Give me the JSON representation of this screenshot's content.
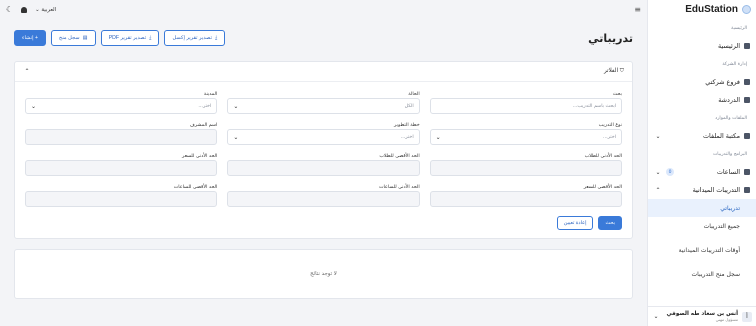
{
  "app": {
    "brand": "EduStation"
  },
  "topbar": {
    "language": "العربية",
    "menu_icon": "hamburger-icon"
  },
  "sidebar": {
    "sections": [
      {
        "title": "الرئيسية",
        "items": [
          {
            "label": "الرئيسية",
            "icon": "home-icon"
          }
        ]
      },
      {
        "title": "إدارة الشركة",
        "items": [
          {
            "label": "فروع شركتي",
            "icon": "building-icon"
          },
          {
            "label": "الدردشة",
            "icon": "chat-icon"
          }
        ]
      },
      {
        "title": "الملفات والموارد",
        "items": [
          {
            "label": "مكتبة الملفات",
            "icon": "folder-icon"
          }
        ]
      },
      {
        "title": "البرامج والتدريبات",
        "items": [
          {
            "label": "الساعات",
            "icon": "clock-icon",
            "badge": "0"
          },
          {
            "label": "التدريبات الميدانية",
            "icon": "training-icon"
          }
        ]
      }
    ],
    "sub_items": [
      "تدريباتي",
      "جميع التدريبات",
      "أوقات التدريبات الميدانية",
      "سجل منح التدريبات"
    ],
    "user": {
      "name": "أنس بن سعاد طه الصوفي",
      "role": "مسؤول مهني",
      "initial": "أ"
    }
  },
  "page": {
    "title": "تدريباتي",
    "buttons": {
      "create": "+ إنشاء",
      "grant_log": "سجل منح",
      "export_pdf": "تصدير تقرير PDF",
      "export_excel": "تصدير تقرير إكسل"
    }
  },
  "filters": {
    "title": "الفلاتر",
    "fields": [
      {
        "label": "بحث",
        "placeholder": "ابحث باسم التدريب..."
      },
      {
        "label": "الحالة",
        "value": "الكل"
      },
      {
        "label": "المدينة",
        "value": "اختر..."
      },
      {
        "label": "نوع التدريب",
        "value": "اختر..."
      },
      {
        "label": "خطة التطوير",
        "value": "اختر..."
      },
      {
        "label": "اسم المشرف",
        "value": ""
      },
      {
        "label": "الحد الأدنى للطلاب",
        "value": ""
      },
      {
        "label": "الحد الأقصى للطلاب",
        "value": ""
      },
      {
        "label": "الحد الأدنى للسعر",
        "value": ""
      },
      {
        "label": "الحد الأقصى للسعر",
        "value": ""
      },
      {
        "label": "الحد الأدنى للساعات",
        "value": ""
      },
      {
        "label": "الحد الأقصى للساعات",
        "value": ""
      }
    ],
    "search_button": "بحث",
    "reset_button": "إعادة تعيين"
  },
  "results": {
    "empty_text": "لا توجد نتائج"
  },
  "colors": {
    "primary": "#3a7ad9",
    "active_bg": "#e9f1fd"
  }
}
